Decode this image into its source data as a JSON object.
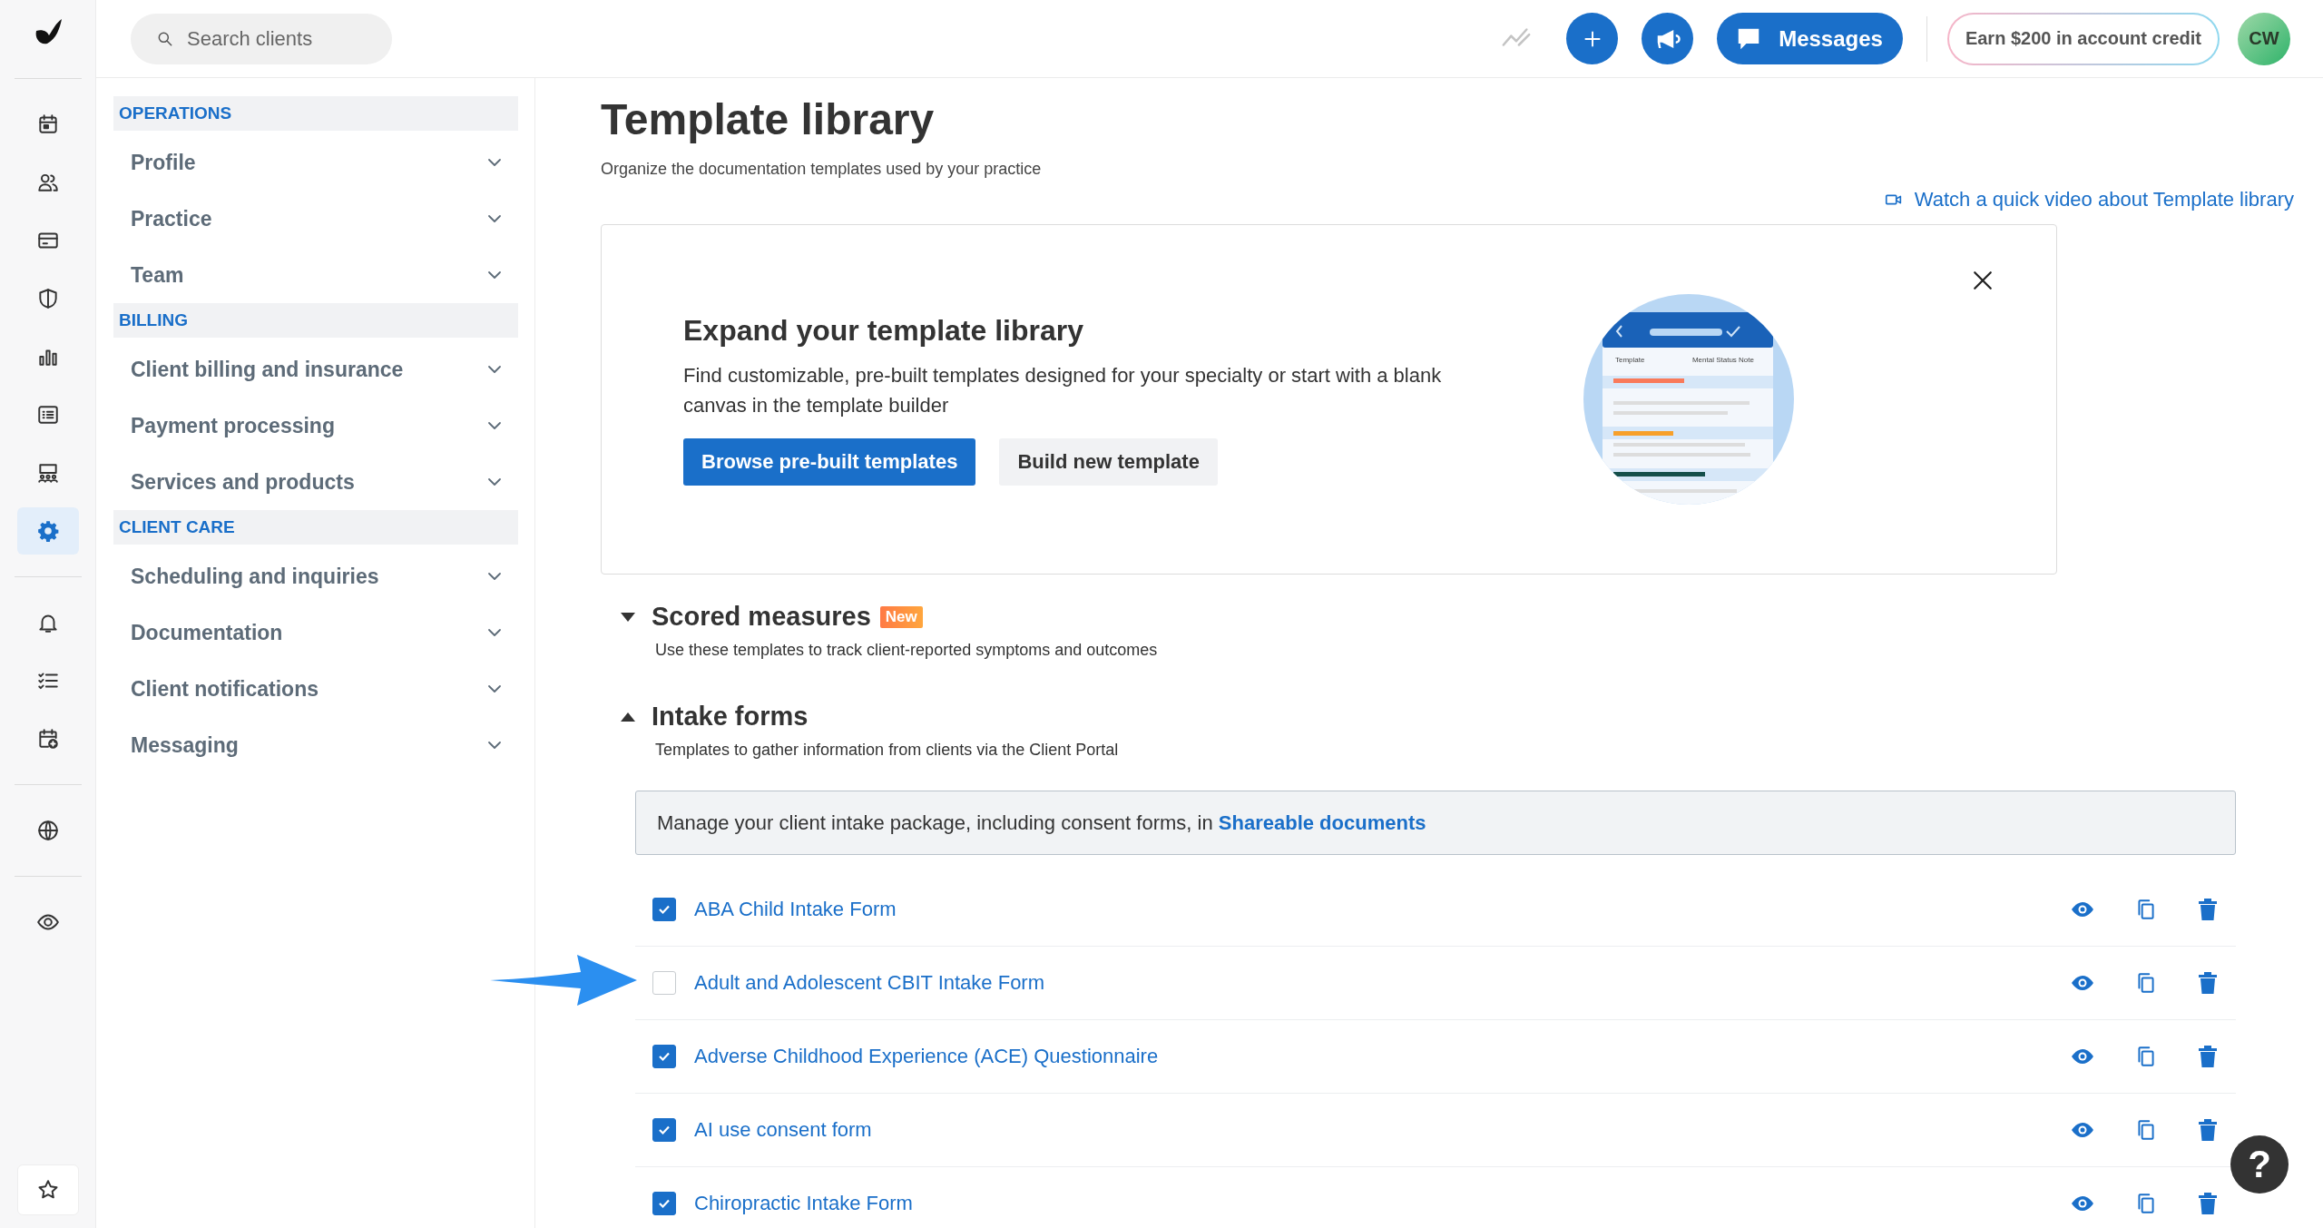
{
  "rail": [
    {
      "selected": false
    },
    {
      "selected": false
    },
    {
      "selected": false
    },
    {
      "selected": false
    },
    {
      "selected": false
    },
    {
      "selected": false
    },
    {
      "selected": false
    },
    {
      "selected": true
    },
    {
      "selected": false
    },
    {
      "selected": false
    },
    {
      "selected": false
    },
    {
      "selected": false
    },
    {
      "selected": false
    },
    {
      "selected": false
    }
  ],
  "search": {
    "placeholder": "Search clients"
  },
  "topbar": {
    "messages": "Messages",
    "credit": "Earn $200 in account credit",
    "avatar": "CW"
  },
  "settings_nav": [
    {
      "title": "OPERATIONS",
      "items": [
        {
          "label": "Profile"
        },
        {
          "label": "Practice"
        },
        {
          "label": "Team"
        }
      ]
    },
    {
      "title": "BILLING",
      "items": [
        {
          "label": "Client billing and insurance"
        },
        {
          "label": "Payment processing"
        },
        {
          "label": "Services and products"
        }
      ]
    },
    {
      "title": "CLIENT CARE",
      "items": [
        {
          "label": "Scheduling and inquiries"
        },
        {
          "label": "Documentation"
        },
        {
          "label": "Client notifications"
        },
        {
          "label": "Messaging"
        }
      ]
    }
  ],
  "page": {
    "title": "Template library",
    "subtitle": "Organize the documentation templates used by your practice",
    "video_link": "Watch a quick video about Template library"
  },
  "banner": {
    "title": "Expand your template library",
    "body": "Find customizable, pre-built templates designed for your specialty or start with a blank canvas in the template builder",
    "primary": "Browse pre-built templates",
    "secondary": "Build new template",
    "illustration": {
      "label": "Template",
      "value": "Mental Status Note"
    }
  },
  "sections": [
    {
      "title": "Scored measures",
      "badge": "New",
      "subtitle": "Use these templates to track client-reported symptoms and outcomes",
      "expanded": false
    },
    {
      "title": "Intake forms",
      "subtitle": "Templates to gather information from clients via the Client Portal",
      "expanded": true
    }
  ],
  "notice": {
    "text": "Manage your client intake package, including consent forms, in",
    "link": "Shareable documents"
  },
  "templates": [
    {
      "name": "ABA Child Intake Form",
      "checked": true
    },
    {
      "name": "Adult and Adolescent CBIT Intake Form",
      "checked": false
    },
    {
      "name": "Adverse Childhood Experience (ACE) Questionnaire",
      "checked": true
    },
    {
      "name": "AI use consent form",
      "checked": true
    },
    {
      "name": "Chiropractic Intake Form",
      "checked": true
    }
  ],
  "help": "?"
}
